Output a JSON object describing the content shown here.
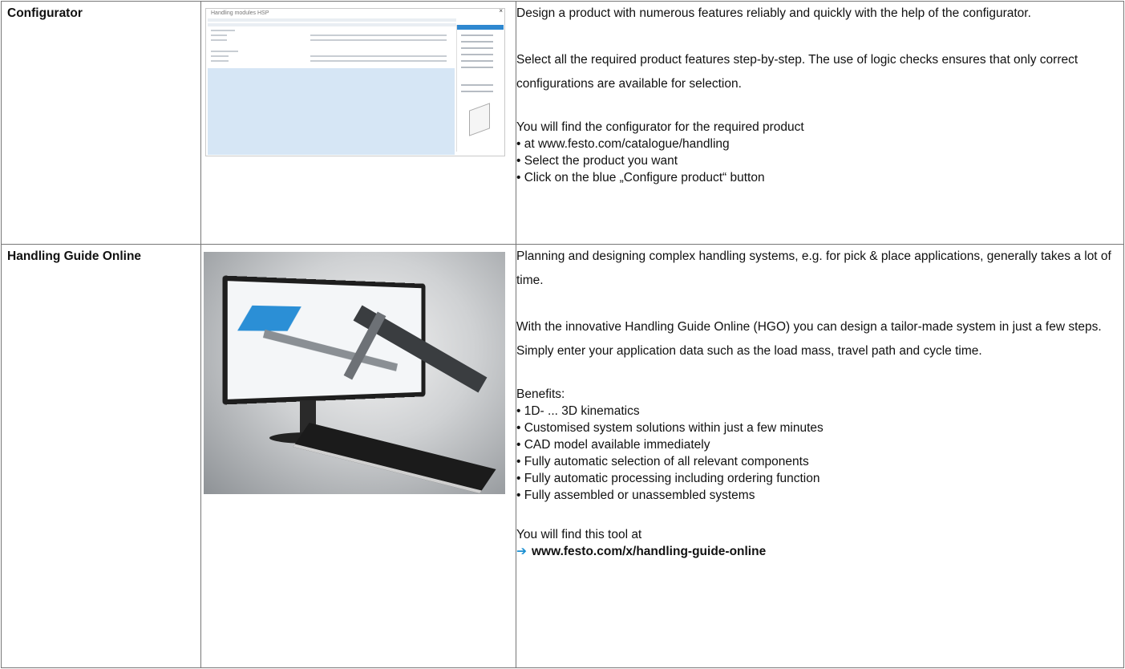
{
  "rows": [
    {
      "label": "Configurator",
      "image": {
        "kind": "configurator-screenshot",
        "title": "Handling modules HSP"
      },
      "paragraphs": [
        "Design a product with numerous features reliably and quickly with the help of the configurator.",
        "Select all the required product features step-by-step. The use of logic checks ensures that only correct configurations are available for selection."
      ],
      "list_intro": "You will find the configurator for the required product",
      "bullets": [
        "at www.festo.com/catalogue/handling",
        "Select the product you want",
        "Click on the blue „Configure product“ button"
      ]
    },
    {
      "label": "Handling Guide Online",
      "image": {
        "kind": "monitor-photo-hgo"
      },
      "paragraphs": [
        "Planning and designing complex handling systems, e.g. for pick & place applications, generally takes a lot of time.",
        "With the innovative Handling Guide Online (HGO) you can design a tailor-made system in just a few steps. Simply enter your application data such as the load mass, travel path and cycle time."
      ],
      "list_intro": "Benefits:",
      "bullets": [
        "1D- ... 3D kinematics",
        "Customised system solutions within just a few minutes",
        "CAD model available immediately",
        "Fully automatic selection of all relevant components",
        "Fully automatic processing including ordering function",
        "Fully assembled or unassembled systems"
      ],
      "closing_intro": "You will find this tool at",
      "link": "www.festo.com/x/handling-guide-online"
    }
  ],
  "colors": {
    "accent_blue": "#2f88d0",
    "link_arrow": "#1a8fd1",
    "border": "#777777"
  },
  "icons": {
    "link_arrow": "arrow-right-icon",
    "bullet": "•"
  }
}
